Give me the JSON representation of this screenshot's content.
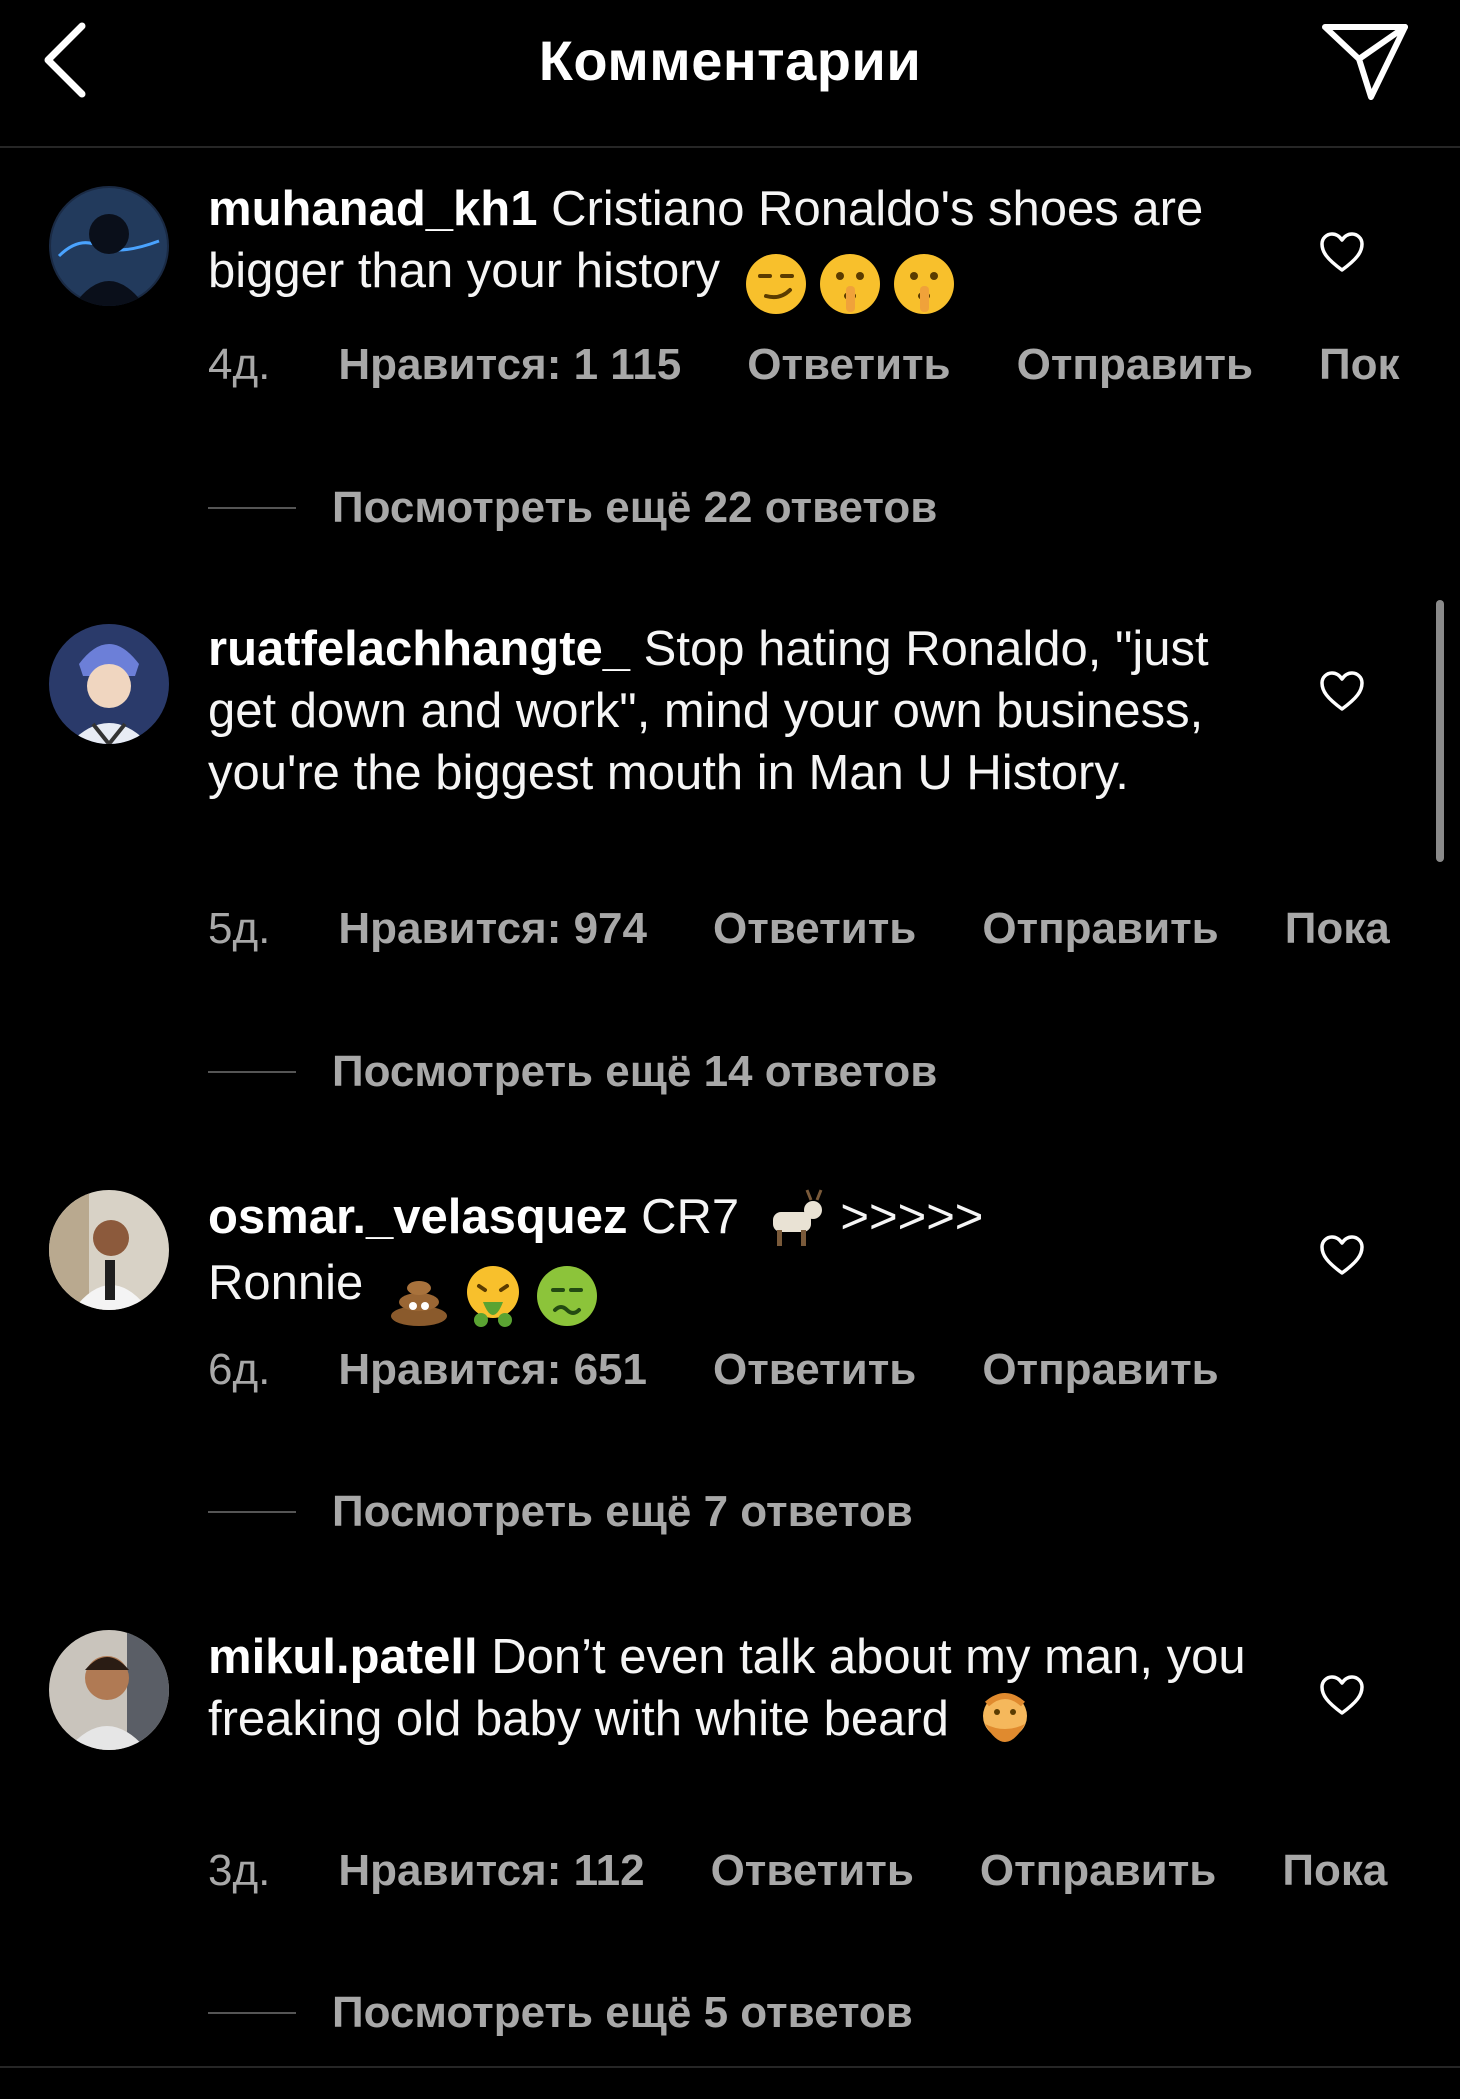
{
  "header": {
    "title": "Комментарии",
    "back_icon": "chevron-left-icon",
    "share_icon": "paper-plane-icon"
  },
  "comments": [
    {
      "username": "muhanad_kh1",
      "text": " Cristiano Ronaldo's shoes are bigger than your history",
      "emojis": [
        "smirk-emoji",
        "shushing-face-emoji",
        "shushing-face-emoji"
      ],
      "time": "4д.",
      "likes": "Нравится: 1 115",
      "reply": "Ответить",
      "send": "Отправить",
      "more": "Пок",
      "view_replies": "Посмотреть ещё 22 ответов"
    },
    {
      "username": "ruatfelachhangte_",
      "text": " Stop hating Ronaldo, \"just get down and work\", mind your own business, you're the biggest mouth in Man U History.",
      "emojis": [],
      "time": "5д.",
      "likes": "Нравится: 974",
      "reply": "Ответить",
      "send": "Отправить",
      "more": "Пока",
      "view_replies": "Посмотреть ещё 14 ответов"
    },
    {
      "username": "osmar._velasquez",
      "text": " CR7",
      "text2": " >>>>>",
      "text3": "Ronnie",
      "emojis": [
        "goat-emoji",
        "pile-of-poo-emoji",
        "vomiting-face-emoji",
        "nauseated-face-emoji"
      ],
      "time": "6д.",
      "likes": "Нравится: 651",
      "reply": "Ответить",
      "send": "Отправить",
      "view_replies": "Посмотреть ещё 7 ответов"
    },
    {
      "username": "mikul.patell",
      "text": " Don’t even talk about my man, you freaking old baby with white beard",
      "emojis": [
        "old-man-emoji"
      ],
      "time": "3д.",
      "likes": "Нравится: 112",
      "reply": "Ответить",
      "send": "Отправить",
      "more": "Пока",
      "view_replies": "Посмотреть ещё 5 ответов"
    }
  ],
  "colors": {
    "background": "#000000",
    "text": "#f5f5f5",
    "secondary": "#a8a8a8",
    "divider": "#262626"
  }
}
